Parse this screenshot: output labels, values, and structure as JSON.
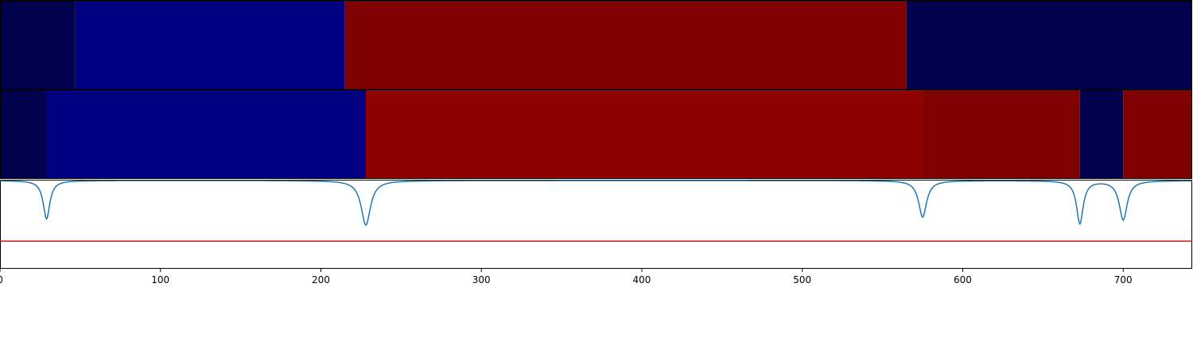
{
  "chart_data": {
    "type": "heatmap",
    "xlim": [
      0,
      743
    ],
    "x_ticks": [
      0,
      100,
      200,
      300,
      400,
      500,
      600,
      700
    ],
    "x_tick_labels": [
      "0",
      "100",
      "200",
      "300",
      "400",
      "500",
      "600",
      "700"
    ],
    "segment_rows": [
      {
        "segments": [
          {
            "start": 0,
            "end": 47,
            "color": "#00004c"
          },
          {
            "start": 47,
            "end": 215,
            "color": "#000080"
          },
          {
            "start": 215,
            "end": 565,
            "color": "#7f0000"
          },
          {
            "start": 565,
            "end": 743,
            "color": "#00004c"
          }
        ]
      },
      {
        "segments": [
          {
            "start": 0,
            "end": 29,
            "color": "#00004c"
          },
          {
            "start": 29,
            "end": 228,
            "color": "#000080"
          },
          {
            "start": 228,
            "end": 575,
            "color": "#8f0000"
          },
          {
            "start": 575,
            "end": 673,
            "color": "#7f0000"
          },
          {
            "start": 673,
            "end": 700,
            "color": "#00004c"
          },
          {
            "start": 700,
            "end": 743,
            "color": "#7f0000"
          }
        ]
      }
    ],
    "signal": {
      "color": "#1f77b4",
      "ylim": [
        0,
        1.0
      ],
      "baseline": 0.99,
      "dips": [
        {
          "center": 29,
          "depth": 0.43,
          "width": 2.5
        },
        {
          "center": 228,
          "depth": 0.5,
          "width": 3.5
        },
        {
          "center": 575,
          "depth": 0.41,
          "width": 3.0
        },
        {
          "center": 673,
          "depth": 0.48,
          "width": 2.5
        },
        {
          "center": 700,
          "depth": 0.44,
          "width": 3.0
        }
      ]
    },
    "threshold": {
      "value": 0.31,
      "color": "#ff0000"
    }
  }
}
